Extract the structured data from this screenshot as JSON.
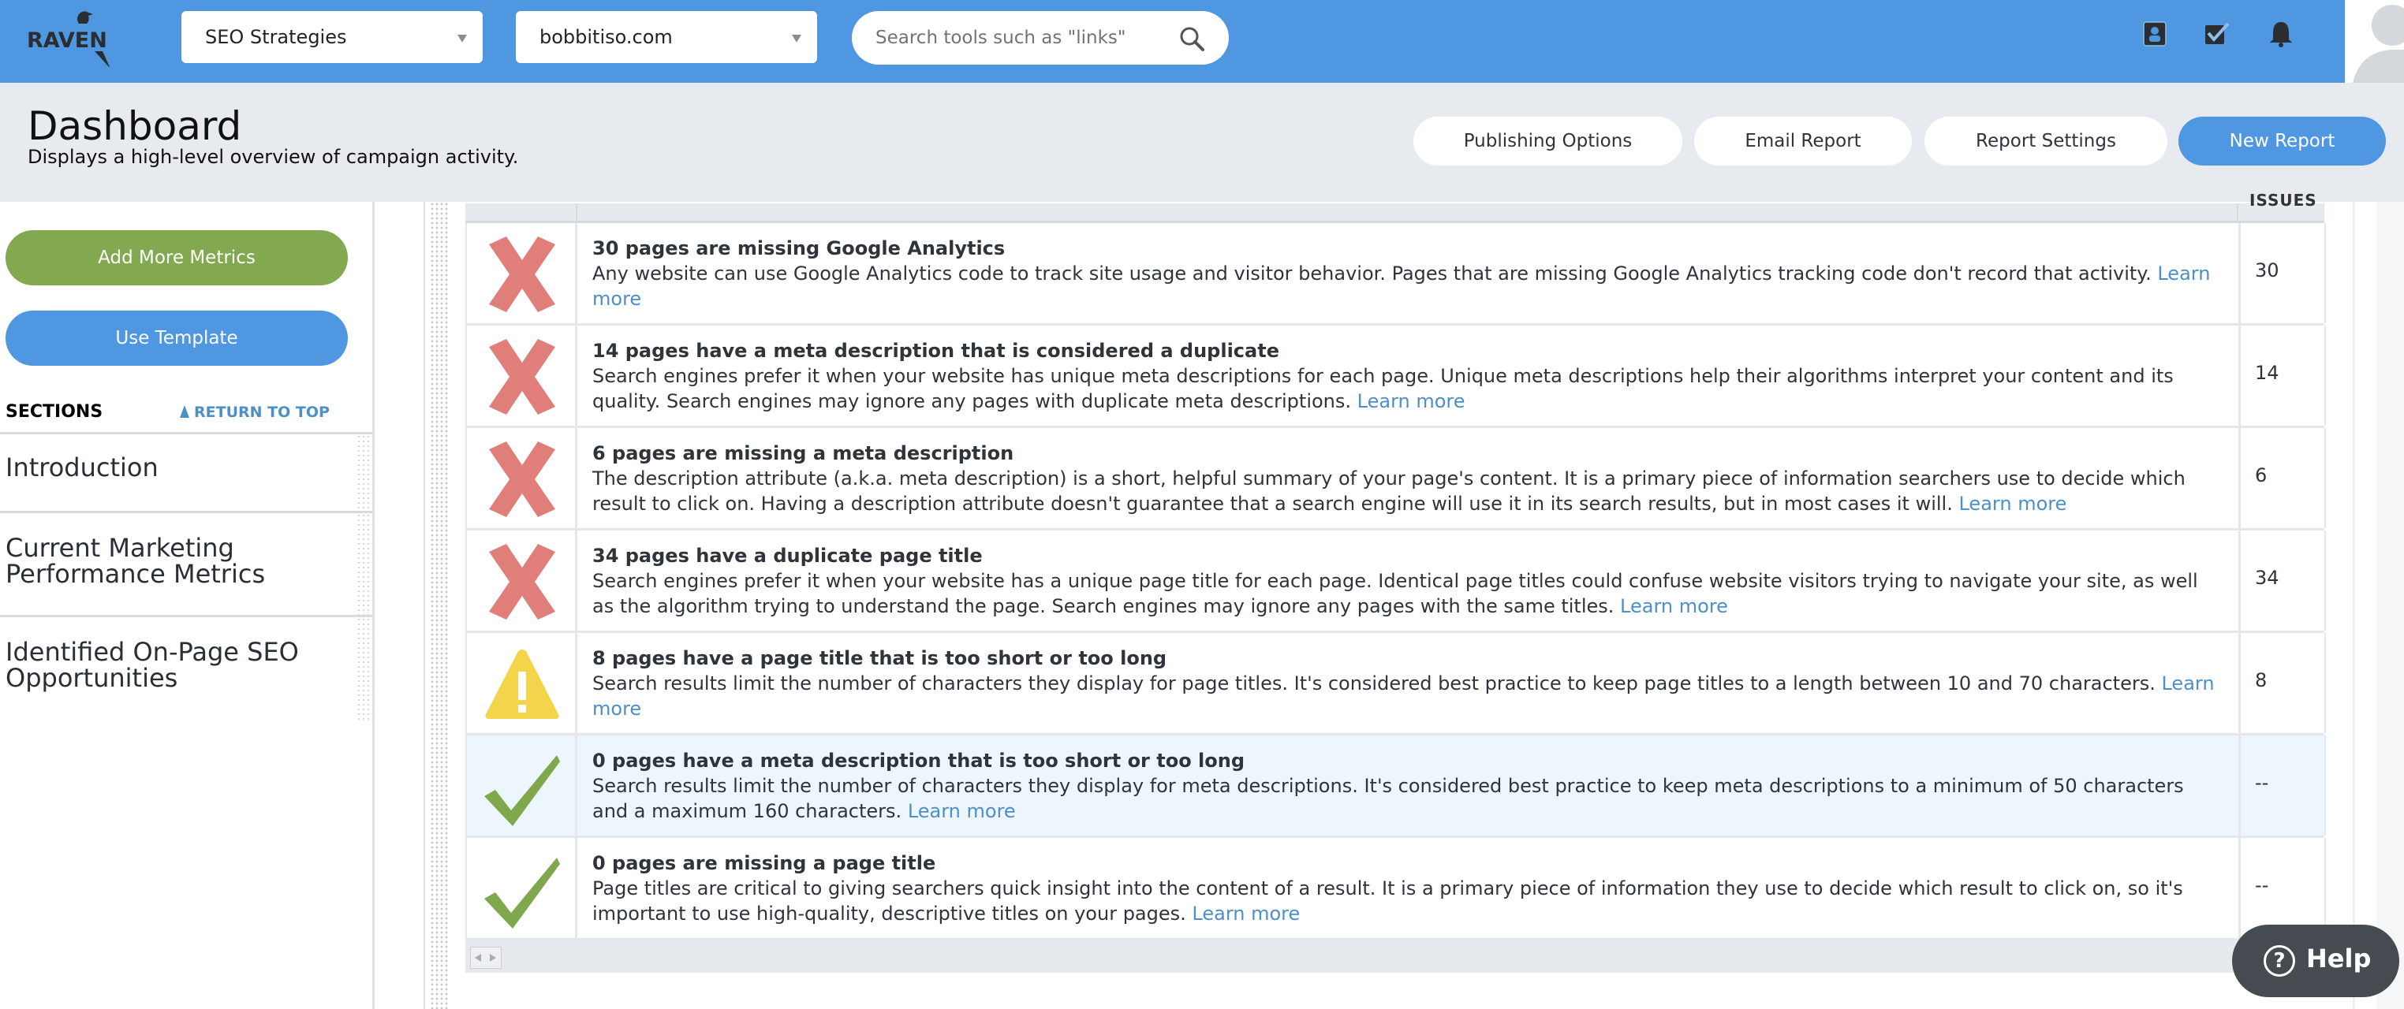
{
  "app": {
    "logo_text": "RAVEN"
  },
  "header": {
    "campaign_select": {
      "value": "SEO Strategies"
    },
    "domain_select": {
      "value": "bobbitiso.com"
    },
    "search": {
      "placeholder": "Search tools such as \"links\"",
      "value": ""
    },
    "icons": [
      "contacts-icon",
      "tasks-checkbox-icon",
      "notifications-bell-icon"
    ],
    "colors": {
      "brand_blue": "#4f97e0"
    }
  },
  "subheader": {
    "title": "Dashboard",
    "subtitle": "Displays a high-level overview of campaign activity.",
    "buttons": {
      "publishing_options": "Publishing Options",
      "email_report": "Email Report",
      "report_settings": "Report Settings",
      "new_report": "New Report"
    }
  },
  "sidebar": {
    "add_more_metrics": "Add More Metrics",
    "use_template": "Use Template",
    "sections_label": "SECTIONS",
    "return_to_top": "RETURN TO TOP",
    "sections": [
      {
        "label": "Introduction"
      },
      {
        "label": "Current Marketing Performance Metrics"
      },
      {
        "label": "Identified On-Page SEO Opportunities"
      }
    ],
    "colors": {
      "add_metrics": "#82a850",
      "use_template": "#4f97e0"
    }
  },
  "table": {
    "header": {
      "issues": "ISSUES"
    },
    "rows": [
      {
        "status": "error",
        "title": "30 pages are missing Google Analytics",
        "description": "Any website can use Google Analytics code to track site usage and visitor behavior. Pages that are missing Google Analytics tracking code don't record that activity.",
        "link": "Learn more",
        "issues": "30"
      },
      {
        "status": "error",
        "title": "14 pages have a meta description that is considered a duplicate",
        "description": "Search engines prefer it when your website has unique meta descriptions for each page. Unique meta descriptions help their algorithms interpret your content and its quality. Search engines may ignore any pages with duplicate meta descriptions.",
        "link": "Learn more",
        "issues": "14"
      },
      {
        "status": "error",
        "title": "6 pages are missing a meta description",
        "description": "The description attribute (a.k.a. meta description) is a short, helpful summary of your page's content. It is a primary piece of information searchers use to decide which result to click on. Having a description attribute doesn't guarantee that a search engine will use it in its search results, but in most cases it will.",
        "link": "Learn more",
        "issues": "6"
      },
      {
        "status": "error",
        "title": "34 pages have a duplicate page title",
        "description": "Search engines prefer it when your website has a unique page title for each page. Identical page titles could confuse website visitors trying to navigate your site, as well as the algorithm trying to understand the page. Search engines may ignore any pages with the same titles.",
        "link": "Learn more",
        "issues": "34"
      },
      {
        "status": "warning",
        "title": "8 pages have a page title that is too short or too long",
        "description": "Search results limit the number of characters they display for page titles. It's considered best practice to keep page titles to a length between 10 and 70 characters.",
        "link": "Learn more",
        "issues": "8"
      },
      {
        "status": "ok",
        "title": "0 pages have a meta description that is too short or too long",
        "description": "Search results limit the number of characters they display for meta descriptions. It's considered best practice to keep meta descriptions to a minimum of 50 characters and a maximum 160 characters.",
        "link": "Learn more",
        "issues": "--",
        "highlighted": true
      },
      {
        "status": "ok",
        "title": "0 pages are missing a page title",
        "description": "Page titles are critical to giving searchers quick insight into the content of a result. It is a primary piece of information they use to decide which result to click on, so it's important to use high-quality, descriptive titles on your pages.",
        "link": "Learn more",
        "issues": "--"
      }
    ],
    "colors": {
      "error": "#e07f7a",
      "warning": "#f4d44a",
      "ok": "#7fa84d",
      "link": "#4c8fc9"
    }
  },
  "help": {
    "label": "Help"
  }
}
